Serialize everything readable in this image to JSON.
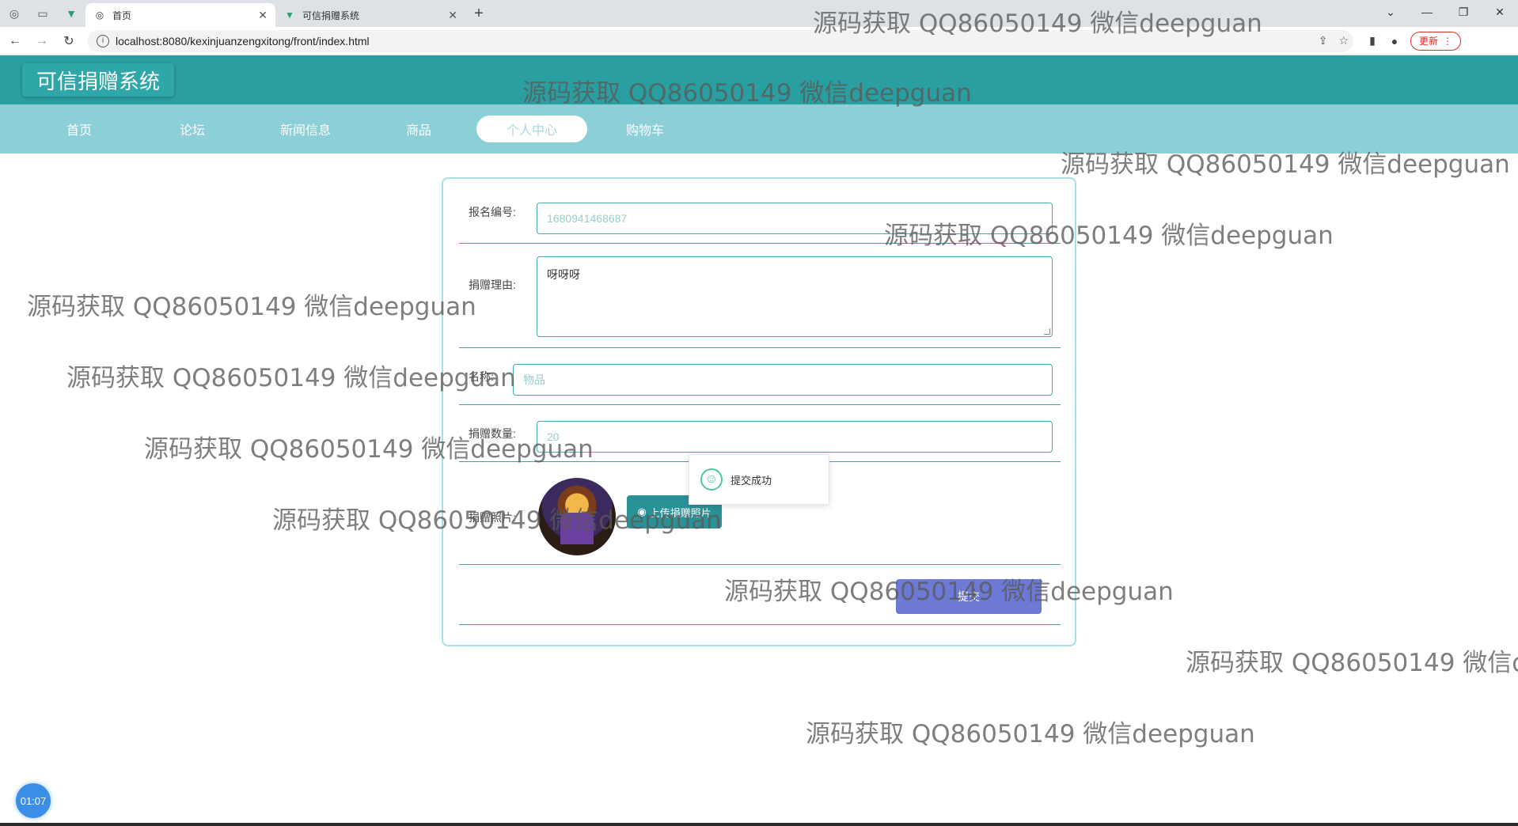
{
  "browser": {
    "tabs": [
      {
        "title": "首页",
        "active": true
      },
      {
        "title": "可信捐赠系统",
        "active": false
      }
    ],
    "url": "localhost:8080/kexinjuanzengxitong/front/index.html",
    "update_label": "更新"
  },
  "site": {
    "title": "可信捐赠系统",
    "nav": [
      "首页",
      "论坛",
      "新闻信息",
      "商品",
      "个人中心",
      "购物车"
    ],
    "active_nav": "个人中心"
  },
  "form": {
    "fields": {
      "registration_no": {
        "label": "报名编号:",
        "value": "1680941468687"
      },
      "reason": {
        "label": "捐赠理由:",
        "value": "呀呀呀"
      },
      "name": {
        "label": "名称:",
        "placeholder": "物品"
      },
      "quantity": {
        "label": "捐赠数量:",
        "value": "20"
      },
      "photo": {
        "label": "捐赠照片:",
        "upload_label": "上传捐赠照片"
      }
    },
    "submit_label": "提交"
  },
  "toast": {
    "message": "提交成功"
  },
  "watermark": "源码获取 QQ86050149 微信deepguan",
  "timer": "01:07",
  "colors": {
    "header": "#2a9fa1",
    "nav": "#8ccfd6",
    "submit": "#6c7ad6",
    "upload": "#2a9196",
    "success": "#52c7a3"
  }
}
